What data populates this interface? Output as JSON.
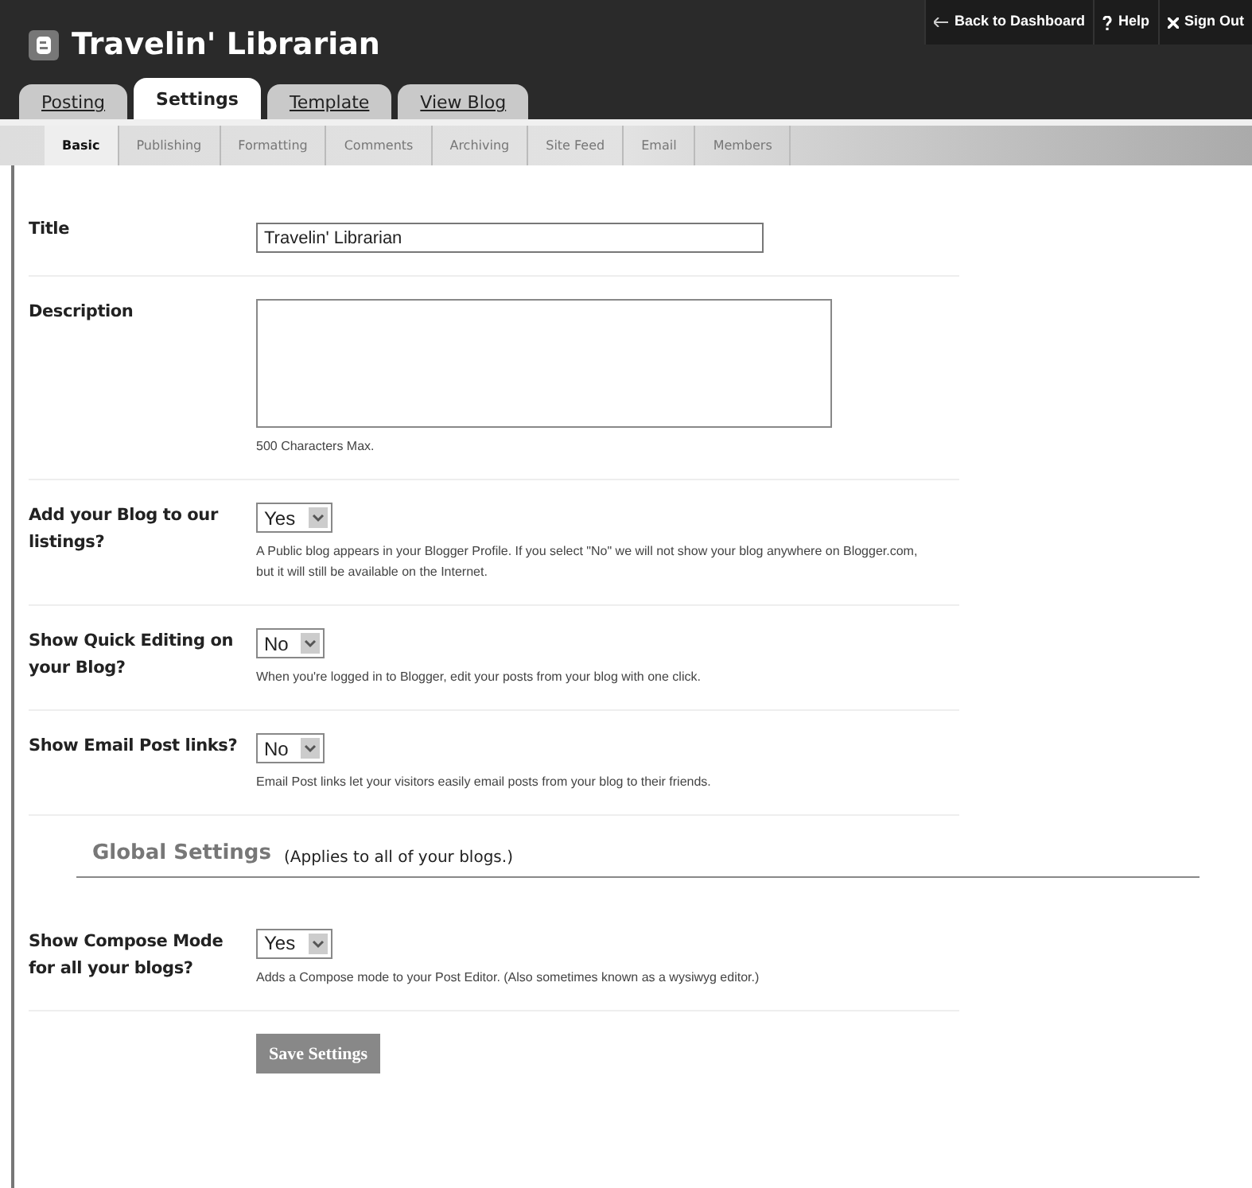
{
  "header": {
    "title": "Travelin' Librarian"
  },
  "top_links": [
    {
      "kind": "arrow",
      "label": "Back to Dashboard"
    },
    {
      "kind": "help",
      "label": "Help"
    },
    {
      "kind": "close",
      "label": "Sign Out"
    }
  ],
  "tabs": [
    {
      "label": "Posting",
      "selected": false
    },
    {
      "label": "Settings",
      "selected": true
    },
    {
      "label": "Template",
      "selected": false
    },
    {
      "label": "View Blog",
      "selected": false
    }
  ],
  "subtabs": [
    {
      "label": "Basic",
      "selected": true
    },
    {
      "label": "Publishing",
      "selected": false
    },
    {
      "label": "Formatting",
      "selected": false
    },
    {
      "label": "Comments",
      "selected": false
    },
    {
      "label": "Archiving",
      "selected": false
    },
    {
      "label": "Site Feed",
      "selected": false
    },
    {
      "label": "Email",
      "selected": false
    },
    {
      "label": "Members",
      "selected": false
    }
  ],
  "settings": [
    {
      "kind": "text",
      "label": "Title",
      "value": "Travelin' Librarian"
    },
    {
      "kind": "textarea",
      "label": "Description",
      "help": "500 Characters Max."
    },
    {
      "kind": "select",
      "label": "Add your Blog to our listings?",
      "value": "Yes",
      "help": "A Public blog appears in your Blogger Profile. If you select \"No\" we will not show your blog anywhere on Blogger.com, but it will still be available on the Internet."
    },
    {
      "kind": "select",
      "label": "Show Quick Editing on your Blog?",
      "value": "No",
      "help": "When you're logged in to Blogger, edit your posts from your blog with one click."
    },
    {
      "kind": "select",
      "label": "Show Email Post links?",
      "value": "No",
      "help": "Email Post links let your visitors easily email posts from your blog to their friends."
    }
  ],
  "global_settings": {
    "heading": "Global Settings",
    "note": "(Applies to all of your blogs.)",
    "settings": [
      {
        "kind": "select",
        "label": "Show Compose Mode for all your blogs?",
        "value": "Yes",
        "help": "Adds a Compose mode to your Post Editor. (Also sometimes known as a wysiwyg editor.)"
      }
    ]
  },
  "save_button": "Save Settings"
}
